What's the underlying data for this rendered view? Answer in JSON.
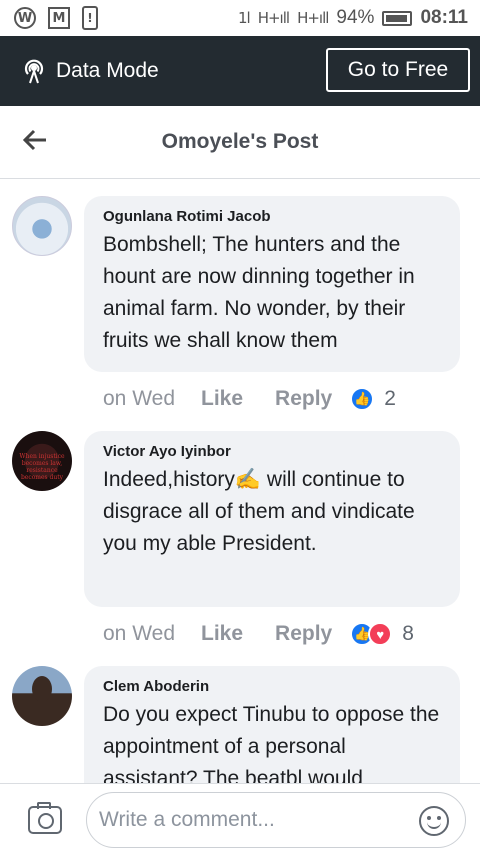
{
  "status_bar": {
    "icons": [
      "W",
      "M",
      "!"
    ],
    "network": "1l",
    "signal1": "H+ıll",
    "signal2": "H+ıll",
    "battery": "94%",
    "time": "08:11"
  },
  "data_bar": {
    "mode_label": "Data Mode",
    "go_free_label": "Go to Free"
  },
  "header": {
    "title": "Omoyele's Post"
  },
  "comments": [
    {
      "author": "Ogunlana Rotimi Jacob",
      "text": "Bombshell; The hunters and the hount are now dinning together in animal farm. No wonder, by their fruits we shall know them",
      "time": "on Wed",
      "like": "Like",
      "reply": "Reply",
      "reactions": [
        "like"
      ],
      "count": "2"
    },
    {
      "author": "Victor Ayo Iyinbor",
      "text": "Indeed,history✍ will continue to disgrace all of them and vindicate you my able President.",
      "time": "on Wed",
      "like": "Like",
      "reply": "Reply",
      "reactions": [
        "like",
        "love"
      ],
      "count": "8",
      "avatar_text": "When injustice becomes law, resistance becomes duty"
    },
    {
      "author": "Clem Aboderin",
      "text": "Do you expect Tinubu to oppose the appointment of a personal assistant? The beatbl would"
    }
  ],
  "composer": {
    "placeholder": "Write a comment..."
  },
  "icons": {
    "back": "arrow-left-icon",
    "data_mode": "broadcast-icon",
    "camera": "camera-icon",
    "emoji": "smiley-icon"
  }
}
